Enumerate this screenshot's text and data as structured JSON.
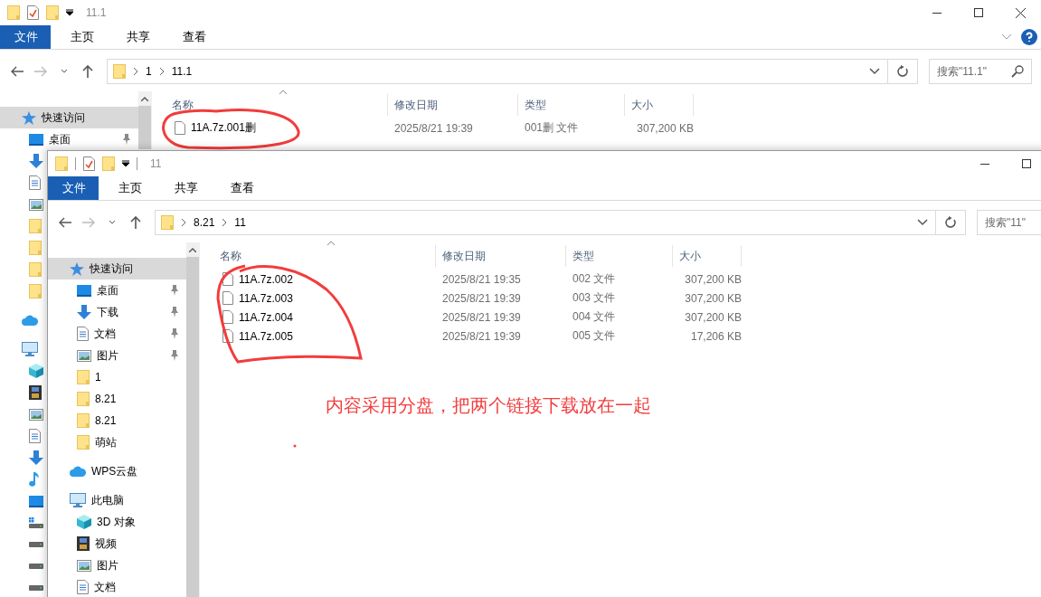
{
  "windows": [
    {
      "title": "11.1",
      "tabs": [
        {
          "label": "文件",
          "selected": true
        },
        {
          "label": "主页",
          "selected": false
        },
        {
          "label": "共享",
          "selected": false
        },
        {
          "label": "查看",
          "selected": false
        }
      ],
      "path": [
        "1",
        "11.1"
      ],
      "search": {
        "placeholder": "搜索\"11.1\""
      },
      "columns": [
        "名称",
        "修改日期",
        "类型",
        "大小"
      ],
      "rows": [
        {
          "name": "11A.7z.001删",
          "modified": "2025/8/21 19:39",
          "type": "001删 文件",
          "size": "307,200 KB"
        }
      ],
      "sidebar": [
        {
          "kind": "star",
          "label": "快速访问",
          "selected": true,
          "children": [
            {
              "kind": "desktop",
              "label": "桌面",
              "pinned": true,
              "selected": false
            },
            {
              "kind": "download"
            },
            {
              "kind": "document"
            },
            {
              "kind": "picture"
            },
            {
              "kind": "folder"
            },
            {
              "kind": "folder"
            },
            {
              "kind": "folder"
            },
            {
              "kind": "folder"
            }
          ]
        },
        {
          "kind": "cloud"
        },
        {
          "kind": "computer",
          "children": [
            {
              "kind": "cube"
            },
            {
              "kind": "video"
            },
            {
              "kind": "picture"
            },
            {
              "kind": "document"
            },
            {
              "kind": "download"
            },
            {
              "kind": "music"
            },
            {
              "kind": "desktop"
            },
            {
              "kind": "drive-windows"
            },
            {
              "kind": "drive"
            },
            {
              "kind": "drive"
            },
            {
              "kind": "drive"
            }
          ]
        }
      ]
    },
    {
      "title": "11",
      "tabs": [
        {
          "label": "文件",
          "selected": true
        },
        {
          "label": "主页",
          "selected": false
        },
        {
          "label": "共享",
          "selected": false
        },
        {
          "label": "查看",
          "selected": false
        }
      ],
      "path": [
        "8.21",
        "11"
      ],
      "search": {
        "placeholder": "搜索\"11\""
      },
      "columns": [
        "名称",
        "修改日期",
        "类型",
        "大小"
      ],
      "rows": [
        {
          "name": "11A.7z.002",
          "modified": "2025/8/21 19:35",
          "type": "002 文件",
          "size": "307,200 KB"
        },
        {
          "name": "11A.7z.003",
          "modified": "2025/8/21 19:39",
          "type": "003 文件",
          "size": "307,200 KB"
        },
        {
          "name": "11A.7z.004",
          "modified": "2025/8/21 19:39",
          "type": "004 文件",
          "size": "307,200 KB"
        },
        {
          "name": "11A.7z.005",
          "modified": "2025/8/21 19:39",
          "type": "005 文件",
          "size": "17,206 KB"
        }
      ],
      "sidebar": [
        {
          "kind": "star",
          "label": "快速访问",
          "selected": true,
          "children": [
            {
              "kind": "desktop",
              "label": "桌面",
              "pinned": true,
              "selected": false
            },
            {
              "kind": "download",
              "label": "下载",
              "pinned": true,
              "selected": false
            },
            {
              "kind": "document",
              "label": "文档",
              "pinned": true,
              "selected": false
            },
            {
              "kind": "picture",
              "label": "图片",
              "pinned": true,
              "selected": false
            },
            {
              "kind": "folder",
              "label": "1",
              "pinned": false,
              "selected": false
            },
            {
              "kind": "folder",
              "label": "8.21",
              "pinned": false,
              "selected": false
            },
            {
              "kind": "folder",
              "label": "8.21",
              "pinned": false,
              "selected": false
            },
            {
              "kind": "folder",
              "label": "萌站",
              "pinned": false,
              "selected": false
            }
          ]
        },
        {
          "kind": "cloud",
          "label": "WPS云盘",
          "selected": false
        },
        {
          "kind": "computer",
          "label": "此电脑",
          "selected": false,
          "children": [
            {
              "kind": "cube",
              "label": "3D 对象",
              "selected": false
            },
            {
              "kind": "video",
              "label": "视频",
              "selected": false
            },
            {
              "kind": "picture",
              "label": "图片",
              "selected": false
            },
            {
              "kind": "document",
              "label": "文档",
              "selected": false
            }
          ]
        }
      ],
      "annotation": {
        "text": "内容采用分盘，把两个链接下载放在一起"
      }
    }
  ]
}
